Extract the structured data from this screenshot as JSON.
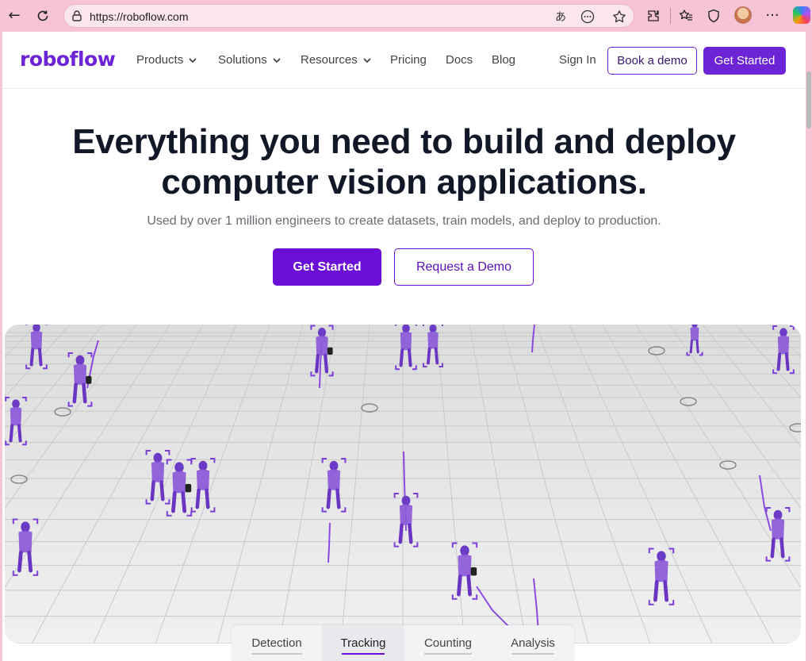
{
  "browser": {
    "url": "https://roboflow.com",
    "read_aloud_glyph": "あ",
    "more_glyph": "···"
  },
  "nav": {
    "logo": "roboflow",
    "items": [
      {
        "label": "Products",
        "dropdown": true
      },
      {
        "label": "Solutions",
        "dropdown": true
      },
      {
        "label": "Resources",
        "dropdown": true
      },
      {
        "label": "Pricing",
        "dropdown": false
      },
      {
        "label": "Docs",
        "dropdown": false
      },
      {
        "label": "Blog",
        "dropdown": false
      }
    ],
    "sign_in": "Sign In",
    "book_demo": "Book a demo",
    "get_started": "Get Started"
  },
  "hero": {
    "title_line1": "Everything you need to build and deploy",
    "title_line2": "computer vision applications.",
    "subtitle": "Used by over 1 million engineers to create datasets, train models, and deploy to production.",
    "primary_cta": "Get Started",
    "secondary_cta": "Request a Demo"
  },
  "demo_tabs": [
    {
      "label": "Detection",
      "active": false
    },
    {
      "label": "Tracking",
      "active": true
    },
    {
      "label": "Counting",
      "active": false
    },
    {
      "label": "Analysis",
      "active": false
    }
  ],
  "colors": {
    "brand": "#6a0ed8",
    "chrome": "#f6c4d6",
    "heading": "#111827"
  }
}
